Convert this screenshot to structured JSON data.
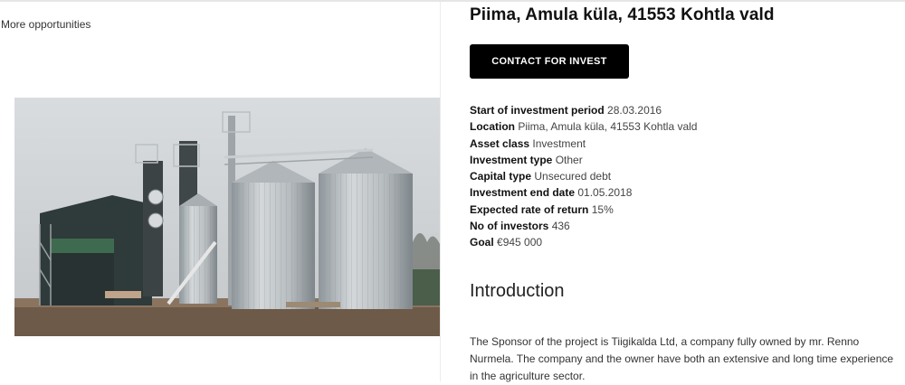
{
  "nav": {
    "more_opportunities": "More opportunities"
  },
  "project": {
    "title": "Piima, Amula küla, 41553 Kohtla vald",
    "cta_label": "CONTACT FOR INVEST",
    "image_alt": "grain silos under construction"
  },
  "details": [
    {
      "key": "Start of investment period",
      "value": "28.03.2016"
    },
    {
      "key": "Location",
      "value": "Piima, Amula küla, 41553 Kohtla vald"
    },
    {
      "key": "Asset class",
      "value": "Investment"
    },
    {
      "key": "Investment type",
      "value": "Other"
    },
    {
      "key": "Capital type",
      "value": "Unsecured debt"
    },
    {
      "key": "Investment end date",
      "value": "01.05.2018"
    },
    {
      "key": "Expected rate of return",
      "value": "15%"
    },
    {
      "key": "No of investors",
      "value": "436"
    },
    {
      "key": "Goal",
      "value": "€945 000"
    }
  ],
  "introduction": {
    "heading": "Introduction",
    "text": "The Sponsor of the project is Tiigikalda Ltd, a company fully owned by mr. Renno Nurmela. The company and the owner have both an extensive and long time experience in the agriculture sector."
  }
}
